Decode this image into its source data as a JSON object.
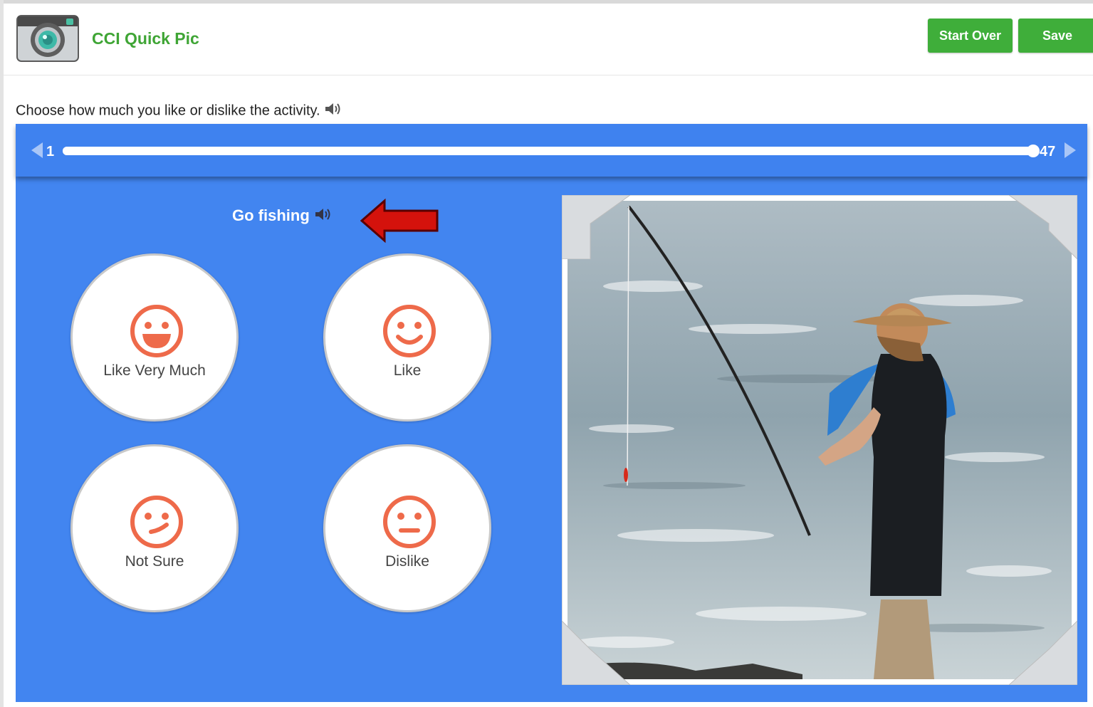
{
  "app": {
    "title": "CCI Quick Pic",
    "start_over_label": "Start Over",
    "save_label": "Save",
    "accent_color": "#3fae3a"
  },
  "instruction": {
    "text": "Choose how much you like or dislike the activity.",
    "icon": "speaker-icon"
  },
  "progress": {
    "start": "1",
    "end": "47",
    "fraction": 1.0
  },
  "activity": {
    "name": "Go fishing",
    "icon": "speaker-icon"
  },
  "choices": [
    {
      "label": "Like Very Much",
      "icon": "big-smile-face-icon"
    },
    {
      "label": "Like",
      "icon": "smile-face-icon"
    },
    {
      "label": "Not Sure",
      "icon": "unsure-face-icon"
    },
    {
      "label": "Dislike",
      "icon": "neutral-face-icon"
    }
  ],
  "colors": {
    "panel": "#4285f0",
    "face": "#ee6a4a",
    "annotation_arrow": "#d4120c"
  }
}
